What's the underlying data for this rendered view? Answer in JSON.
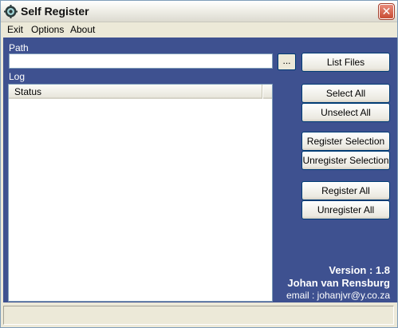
{
  "window": {
    "title": "Self Register",
    "close_glyph": "✕"
  },
  "menu": {
    "exit": "Exit",
    "options": "Options",
    "about": "About"
  },
  "path": {
    "label": "Path",
    "value": "",
    "browse_label": "..."
  },
  "log": {
    "label": "Log",
    "column_status": "Status"
  },
  "buttons": {
    "list_files": "List Files",
    "select_all": "Select All",
    "unselect_all": "Unselect All",
    "register_selection": "Register Selection",
    "unregister_selection": "Unregister Selection",
    "register_all": "Register All",
    "unregister_all": "Unregister All"
  },
  "info": {
    "version": "Version : 1.8",
    "author": "Johan van Rensburg",
    "email": "email : johanjvr@y.co.za"
  },
  "colors": {
    "panel": "#3e5190",
    "chrome": "#ece9d8",
    "close_button": "#c84c34"
  },
  "icons": {
    "app": "app-gear-icon",
    "close": "close-icon"
  }
}
